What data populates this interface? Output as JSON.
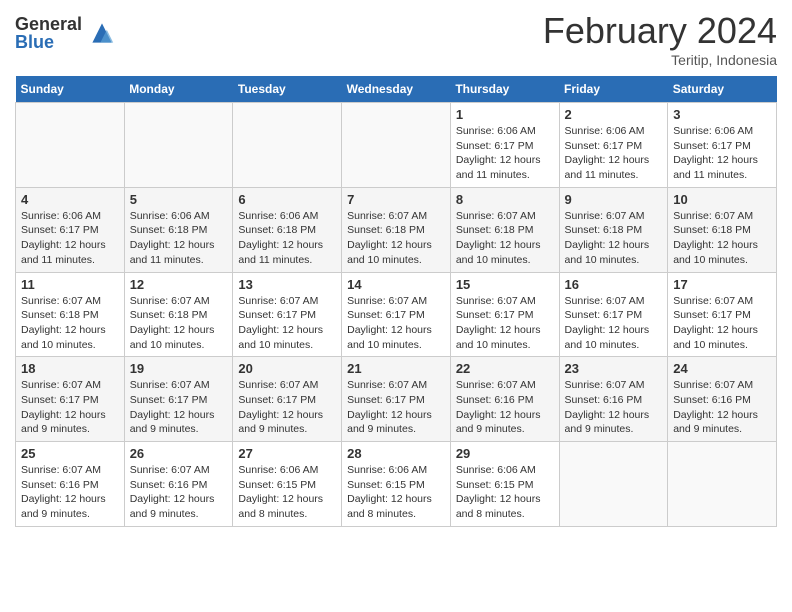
{
  "header": {
    "logo_general": "General",
    "logo_blue": "Blue",
    "month_title": "February 2024",
    "location": "Teritip, Indonesia"
  },
  "calendar": {
    "days_of_week": [
      "Sunday",
      "Monday",
      "Tuesday",
      "Wednesday",
      "Thursday",
      "Friday",
      "Saturday"
    ],
    "weeks": [
      [
        {
          "num": "",
          "info": ""
        },
        {
          "num": "",
          "info": ""
        },
        {
          "num": "",
          "info": ""
        },
        {
          "num": "",
          "info": ""
        },
        {
          "num": "1",
          "info": "Sunrise: 6:06 AM\nSunset: 6:17 PM\nDaylight: 12 hours\nand 11 minutes."
        },
        {
          "num": "2",
          "info": "Sunrise: 6:06 AM\nSunset: 6:17 PM\nDaylight: 12 hours\nand 11 minutes."
        },
        {
          "num": "3",
          "info": "Sunrise: 6:06 AM\nSunset: 6:17 PM\nDaylight: 12 hours\nand 11 minutes."
        }
      ],
      [
        {
          "num": "4",
          "info": "Sunrise: 6:06 AM\nSunset: 6:17 PM\nDaylight: 12 hours\nand 11 minutes."
        },
        {
          "num": "5",
          "info": "Sunrise: 6:06 AM\nSunset: 6:18 PM\nDaylight: 12 hours\nand 11 minutes."
        },
        {
          "num": "6",
          "info": "Sunrise: 6:06 AM\nSunset: 6:18 PM\nDaylight: 12 hours\nand 11 minutes."
        },
        {
          "num": "7",
          "info": "Sunrise: 6:07 AM\nSunset: 6:18 PM\nDaylight: 12 hours\nand 10 minutes."
        },
        {
          "num": "8",
          "info": "Sunrise: 6:07 AM\nSunset: 6:18 PM\nDaylight: 12 hours\nand 10 minutes."
        },
        {
          "num": "9",
          "info": "Sunrise: 6:07 AM\nSunset: 6:18 PM\nDaylight: 12 hours\nand 10 minutes."
        },
        {
          "num": "10",
          "info": "Sunrise: 6:07 AM\nSunset: 6:18 PM\nDaylight: 12 hours\nand 10 minutes."
        }
      ],
      [
        {
          "num": "11",
          "info": "Sunrise: 6:07 AM\nSunset: 6:18 PM\nDaylight: 12 hours\nand 10 minutes."
        },
        {
          "num": "12",
          "info": "Sunrise: 6:07 AM\nSunset: 6:18 PM\nDaylight: 12 hours\nand 10 minutes."
        },
        {
          "num": "13",
          "info": "Sunrise: 6:07 AM\nSunset: 6:17 PM\nDaylight: 12 hours\nand 10 minutes."
        },
        {
          "num": "14",
          "info": "Sunrise: 6:07 AM\nSunset: 6:17 PM\nDaylight: 12 hours\nand 10 minutes."
        },
        {
          "num": "15",
          "info": "Sunrise: 6:07 AM\nSunset: 6:17 PM\nDaylight: 12 hours\nand 10 minutes."
        },
        {
          "num": "16",
          "info": "Sunrise: 6:07 AM\nSunset: 6:17 PM\nDaylight: 12 hours\nand 10 minutes."
        },
        {
          "num": "17",
          "info": "Sunrise: 6:07 AM\nSunset: 6:17 PM\nDaylight: 12 hours\nand 10 minutes."
        }
      ],
      [
        {
          "num": "18",
          "info": "Sunrise: 6:07 AM\nSunset: 6:17 PM\nDaylight: 12 hours\nand 9 minutes."
        },
        {
          "num": "19",
          "info": "Sunrise: 6:07 AM\nSunset: 6:17 PM\nDaylight: 12 hours\nand 9 minutes."
        },
        {
          "num": "20",
          "info": "Sunrise: 6:07 AM\nSunset: 6:17 PM\nDaylight: 12 hours\nand 9 minutes."
        },
        {
          "num": "21",
          "info": "Sunrise: 6:07 AM\nSunset: 6:17 PM\nDaylight: 12 hours\nand 9 minutes."
        },
        {
          "num": "22",
          "info": "Sunrise: 6:07 AM\nSunset: 6:16 PM\nDaylight: 12 hours\nand 9 minutes."
        },
        {
          "num": "23",
          "info": "Sunrise: 6:07 AM\nSunset: 6:16 PM\nDaylight: 12 hours\nand 9 minutes."
        },
        {
          "num": "24",
          "info": "Sunrise: 6:07 AM\nSunset: 6:16 PM\nDaylight: 12 hours\nand 9 minutes."
        }
      ],
      [
        {
          "num": "25",
          "info": "Sunrise: 6:07 AM\nSunset: 6:16 PM\nDaylight: 12 hours\nand 9 minutes."
        },
        {
          "num": "26",
          "info": "Sunrise: 6:07 AM\nSunset: 6:16 PM\nDaylight: 12 hours\nand 9 minutes."
        },
        {
          "num": "27",
          "info": "Sunrise: 6:06 AM\nSunset: 6:15 PM\nDaylight: 12 hours\nand 8 minutes."
        },
        {
          "num": "28",
          "info": "Sunrise: 6:06 AM\nSunset: 6:15 PM\nDaylight: 12 hours\nand 8 minutes."
        },
        {
          "num": "29",
          "info": "Sunrise: 6:06 AM\nSunset: 6:15 PM\nDaylight: 12 hours\nand 8 minutes."
        },
        {
          "num": "",
          "info": ""
        },
        {
          "num": "",
          "info": ""
        }
      ]
    ]
  }
}
